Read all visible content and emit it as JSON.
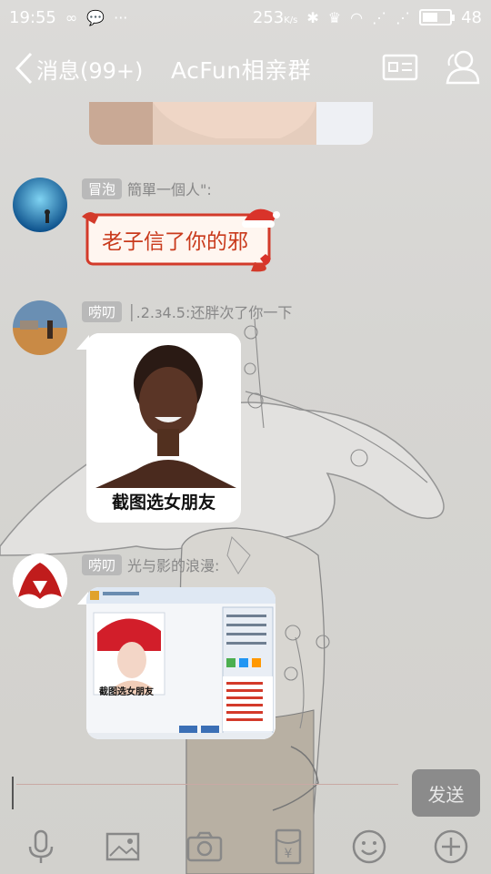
{
  "status_bar": {
    "time": "19:55",
    "speed": "253",
    "speed_unit": "K/s",
    "battery": "48"
  },
  "header": {
    "back_label": "消息(99+)",
    "title": "AcFun相亲群"
  },
  "messages": [
    {
      "badge": "冒泡",
      "sender": "簡單一個人\":",
      "sticker_text": "老子信了你的邪"
    },
    {
      "badge": "唠叨",
      "sender": "│.2.з4.5:还胖次了你一下",
      "image_caption": "截图选女朋友"
    },
    {
      "badge": "唠叨",
      "sender": "光与影的浪漫:",
      "image_caption": "截图选女朋友"
    }
  ],
  "input": {
    "value": "",
    "send_label": "发送"
  },
  "toolbar": [
    {
      "icon": "microphone-icon"
    },
    {
      "icon": "image-icon"
    },
    {
      "icon": "camera-icon"
    },
    {
      "icon": "red-packet-icon"
    },
    {
      "icon": "emoji-icon"
    },
    {
      "icon": "plus-icon"
    }
  ],
  "colors": {
    "header_text": "#ffffff",
    "badge_bg": "#b9b9b9",
    "sticker_text": "#c93a1c",
    "send_button_bg": "#8b8b8b"
  }
}
